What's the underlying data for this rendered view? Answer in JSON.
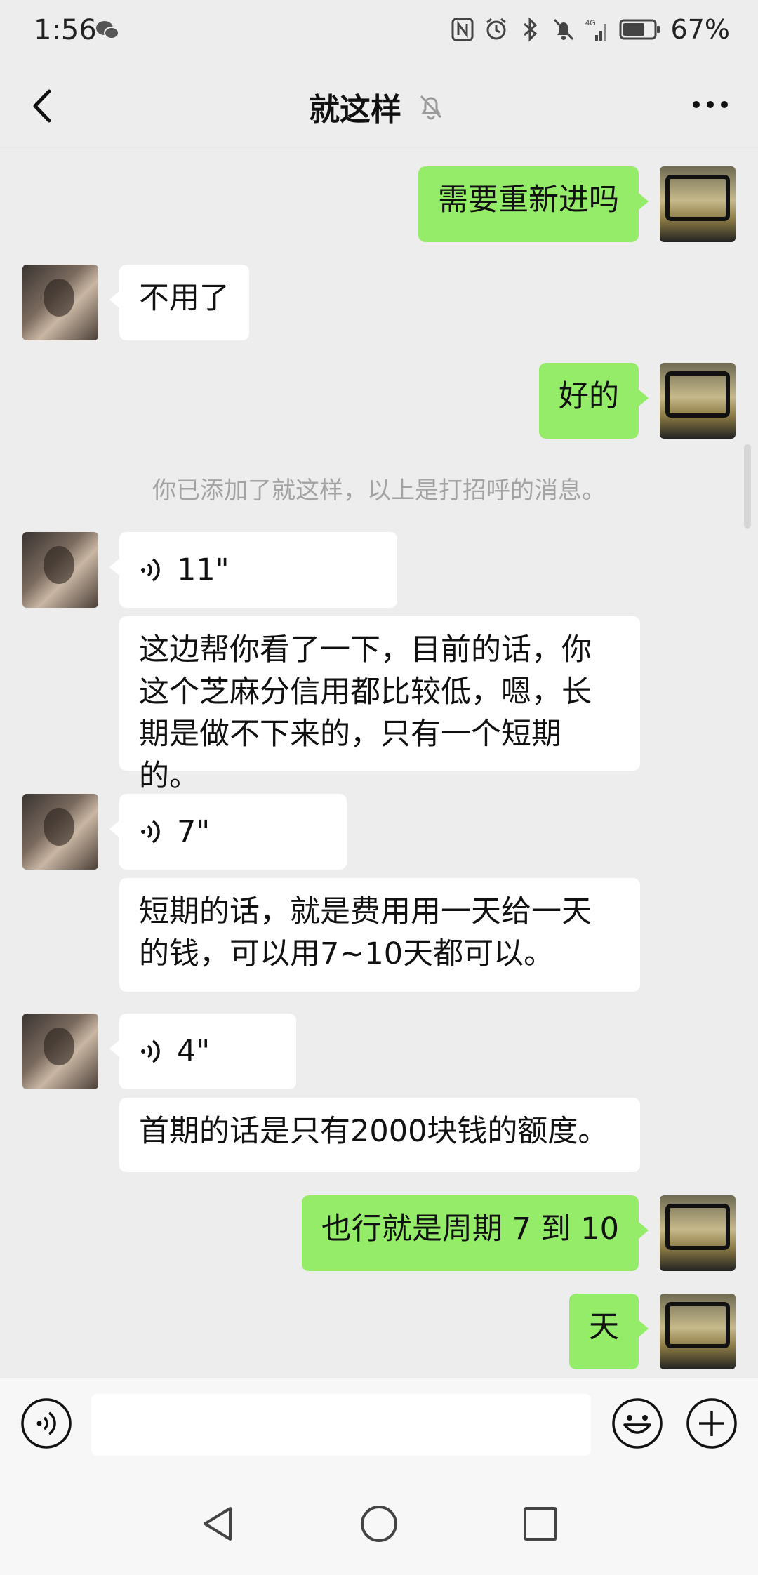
{
  "status_bar": {
    "time": "1:56",
    "battery_pct": "67%",
    "network": "4G"
  },
  "header": {
    "title": "就这样",
    "muted": true
  },
  "messages": [
    {
      "side": "out",
      "type": "text",
      "text": "需要重新进吗"
    },
    {
      "side": "in",
      "type": "text",
      "text": "不用了"
    },
    {
      "side": "out",
      "type": "text",
      "text": "好的"
    },
    {
      "side": "system",
      "type": "system",
      "text": "你已添加了就这样，以上是打招呼的消息。"
    },
    {
      "side": "in",
      "type": "voice",
      "duration": "11\""
    },
    {
      "side": "in",
      "type": "transcript",
      "lines": [
        "这边帮你看了一下，目前的话，你",
        "这个芝麻分信用都比较低，嗯，长",
        "期是做不下来的，只有一个短期的。"
      ]
    },
    {
      "side": "in",
      "type": "voice",
      "duration": "7\""
    },
    {
      "side": "in",
      "type": "transcript",
      "lines": [
        "短期的话，就是费用用一天给一天",
        "的钱，可以用7~10天都可以。"
      ]
    },
    {
      "side": "in",
      "type": "voice",
      "duration": "4\""
    },
    {
      "side": "in",
      "type": "transcript",
      "lines": [
        "首期的话是只有2000块钱的额度。"
      ]
    },
    {
      "side": "out",
      "type": "text",
      "text": "也行就是周期 7 到 10"
    },
    {
      "side": "out",
      "type": "text",
      "text": "天"
    }
  ],
  "input_bar": {
    "value": ""
  },
  "icons": {
    "back": "chevron-left-icon",
    "mute": "bell-off-icon",
    "more": "more-dots-icon",
    "voice_input": "voice-input-icon",
    "emoji": "emoji-icon",
    "plus": "plus-icon",
    "sys_back": "triangle-back-icon",
    "sys_home": "circle-home-icon",
    "sys_recent": "square-recent-icon"
  },
  "colors": {
    "outgoing_bubble": "#95ec69",
    "incoming_bubble": "#ffffff",
    "background": "#ededed"
  }
}
